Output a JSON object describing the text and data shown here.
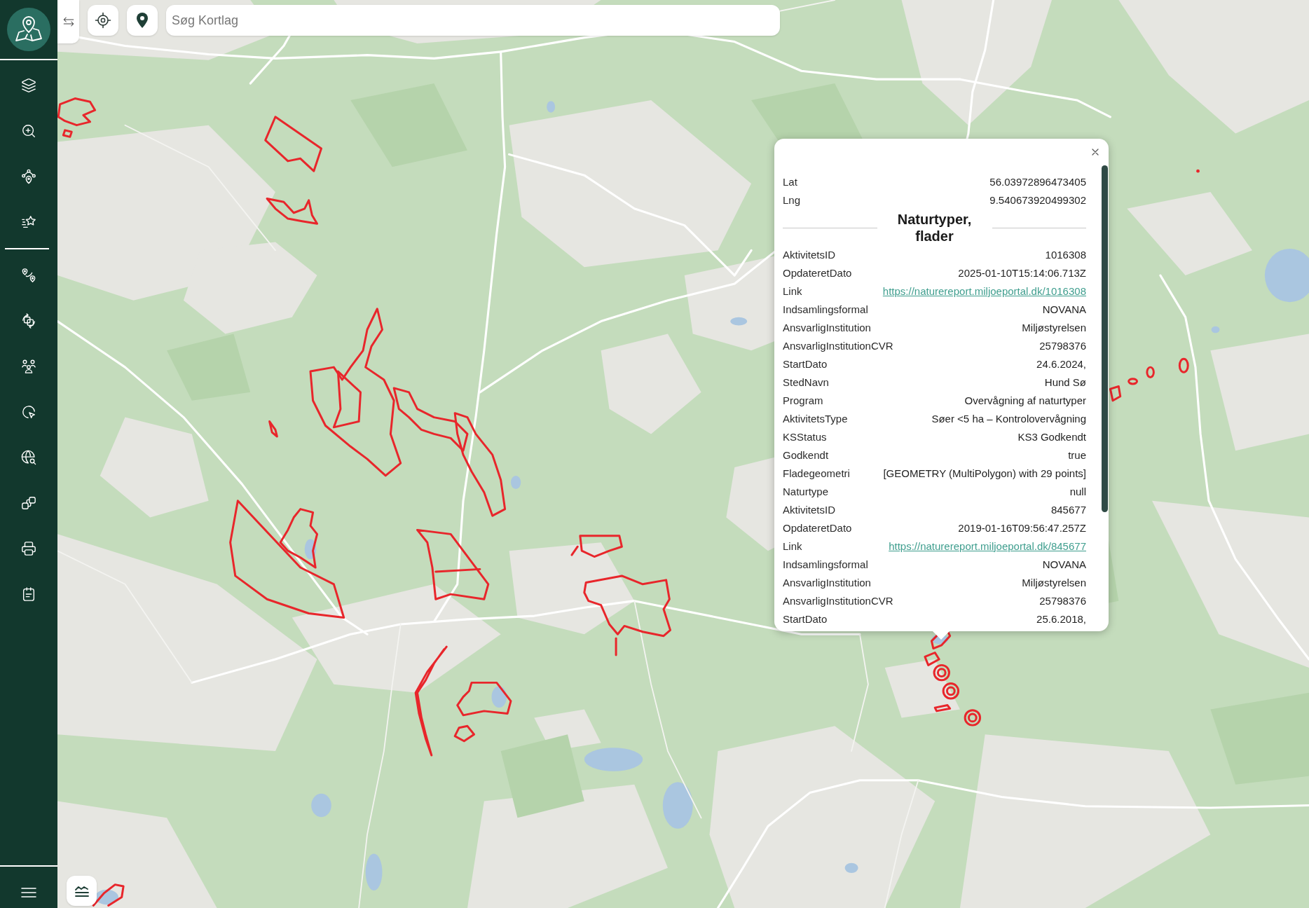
{
  "search": {
    "placeholder": "Søg Kortlag"
  },
  "popup": {
    "coordinates": [
      {
        "label": "Lat",
        "value": "56.03972896473405"
      },
      {
        "label": "Lng",
        "value": "9.540673920499302"
      }
    ],
    "sections": [
      {
        "title": "Naturtyper, flader",
        "fields": [
          {
            "label": "AktivitetsID",
            "value": "1016308",
            "kind": "text"
          },
          {
            "label": "OpdateretDato",
            "value": "2025-01-10T15:14:06.713Z",
            "kind": "text"
          },
          {
            "label": "Link",
            "value": "https://naturereport.miljoeportal.dk/1016308",
            "kind": "link"
          },
          {
            "label": "Indsamlingsformal",
            "value": "NOVANA",
            "kind": "text"
          },
          {
            "label": "AnsvarligInstitution",
            "value": "Miljøstyrelsen",
            "kind": "text"
          },
          {
            "label": "AnsvarligInstitutionCVR",
            "value": "25798376",
            "kind": "text"
          },
          {
            "label": "StartDato",
            "value": "24.6.2024,",
            "kind": "text"
          },
          {
            "label": "StedNavn",
            "value": "Hund Sø",
            "kind": "text"
          },
          {
            "label": "Program",
            "value": "Overvågning af naturtyper",
            "kind": "text"
          },
          {
            "label": "AktivitetsType",
            "value": "Søer <5 ha – Kontrolovervågning",
            "kind": "text"
          },
          {
            "label": "KSStatus",
            "value": "KS3 Godkendt",
            "kind": "text"
          },
          {
            "label": "Godkendt",
            "value": "true",
            "kind": "text"
          },
          {
            "label": "Fladegeometri",
            "value": "[GEOMETRY (MultiPolygon) with 29 points]",
            "kind": "text"
          },
          {
            "label": "Naturtype",
            "value": "null",
            "kind": "text"
          },
          {
            "label": "AktivitetsID",
            "value": "845677",
            "kind": "text"
          },
          {
            "label": "OpdateretDato",
            "value": "2019-01-16T09:56:47.257Z",
            "kind": "text"
          },
          {
            "label": "Link",
            "value": "https://naturereport.miljoeportal.dk/845677",
            "kind": "link"
          },
          {
            "label": "Indsamlingsformal",
            "value": "NOVANA",
            "kind": "text"
          },
          {
            "label": "AnsvarligInstitution",
            "value": "Miljøstyrelsen",
            "kind": "text"
          },
          {
            "label": "AnsvarligInstitutionCVR",
            "value": "25798376",
            "kind": "text"
          },
          {
            "label": "StartDato",
            "value": "25.6.2018,",
            "kind": "text"
          }
        ]
      }
    ]
  }
}
